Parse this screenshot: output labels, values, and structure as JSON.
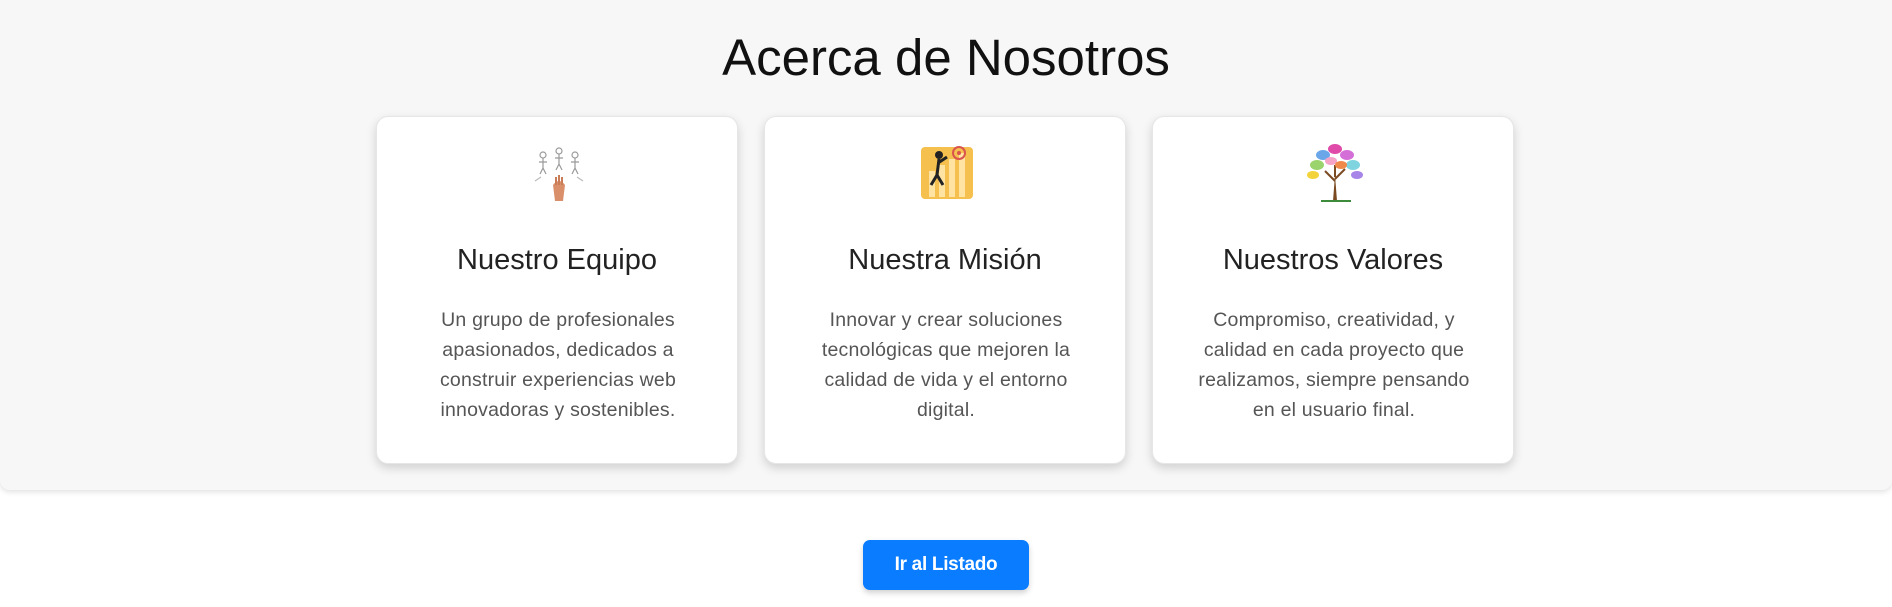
{
  "about": {
    "title": "Acerca de Nosotros",
    "cards": [
      {
        "icon": "team-hands-illustration",
        "title": "Nuestro Equipo",
        "text": "Un grupo de profesionales apasionados, dedicados a construir experiencias web innovadoras y sostenibles."
      },
      {
        "icon": "mission-growth-chart-illustration",
        "title": "Nuestra Misión",
        "text": "Innovar y crear soluciones tecnológicas que mejoren la calidad de vida y el entorno digital."
      },
      {
        "icon": "values-tree-illustration",
        "title": "Nuestros Valores",
        "text": "Compromiso, creatividad, y calidad en cada proyecto que realizamos, siempre pensando en el usuario final."
      }
    ]
  },
  "cta": {
    "label": "Ir al Listado"
  },
  "colors": {
    "accent": "#0a7cff",
    "section_bg": "#f7f7f7"
  }
}
